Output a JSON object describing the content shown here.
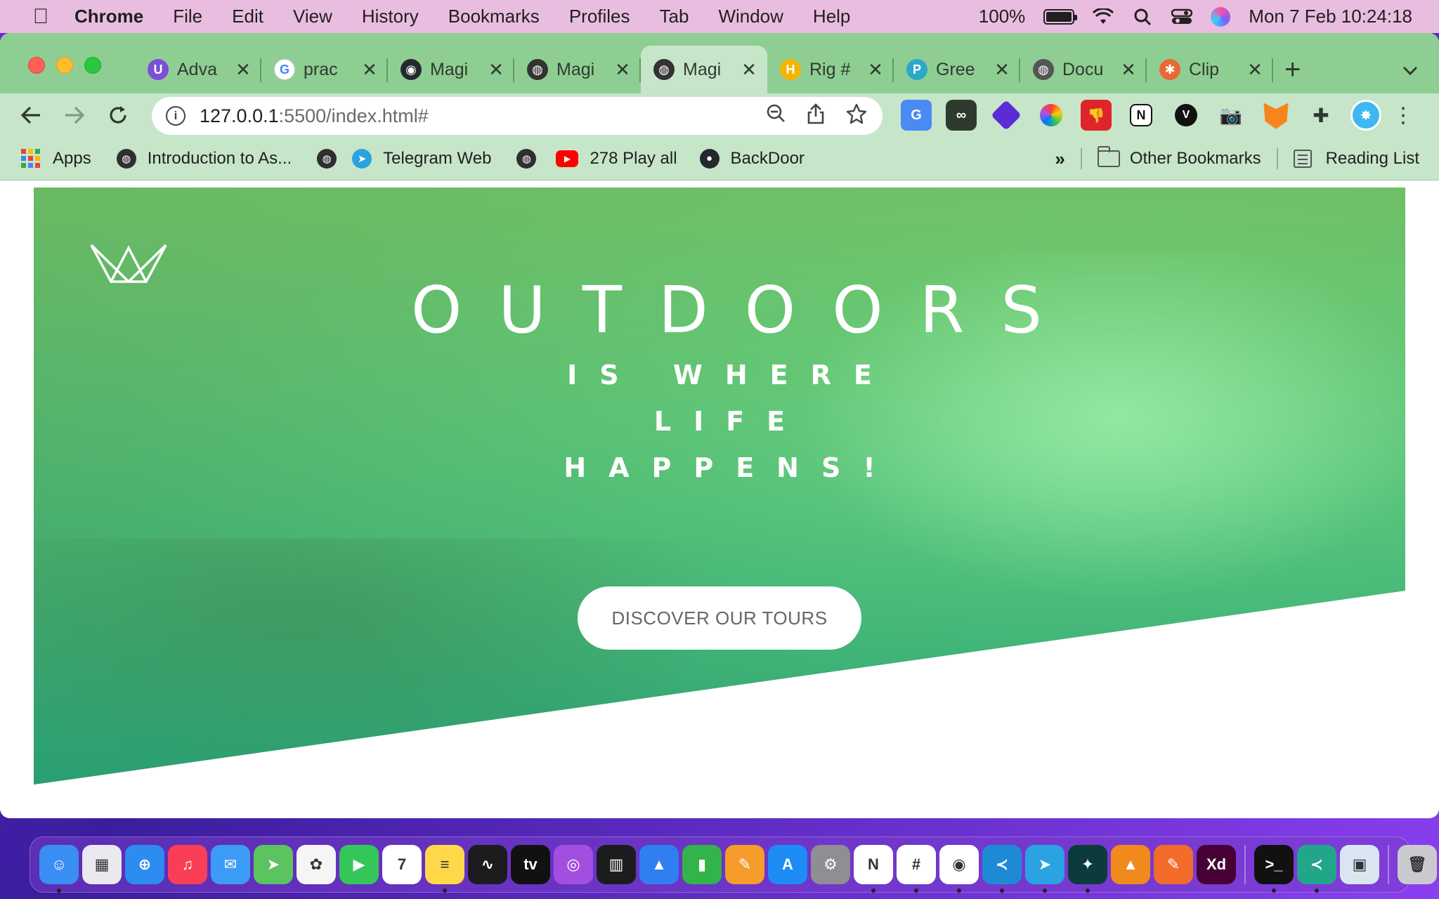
{
  "menubar": {
    "app_name": "Chrome",
    "menus": [
      "File",
      "Edit",
      "View",
      "History",
      "Bookmarks",
      "Profiles",
      "Tab",
      "Window",
      "Help"
    ],
    "battery_percent": "100%",
    "battery_level": 1.0,
    "datetime": "Mon 7 Feb  10:24:18"
  },
  "tabs": [
    {
      "title": "Adva",
      "favicon": "ublock-icon",
      "color": "#7b4fd6",
      "glyph": "U"
    },
    {
      "title": "prac",
      "favicon": "google-icon",
      "color": "#ffffff",
      "glyph": "G"
    },
    {
      "title": "Magi",
      "favicon": "github-icon",
      "color": "#24292f",
      "glyph": "◉"
    },
    {
      "title": "Magi",
      "favicon": "globe-icon",
      "color": "#333333",
      "glyph": "◍"
    },
    {
      "title": "Magi",
      "favicon": "globe-icon",
      "color": "#333333",
      "glyph": "◍",
      "active": true
    },
    {
      "title": "Rig #",
      "favicon": "hive-icon",
      "color": "#f5b400",
      "glyph": "H"
    },
    {
      "title": "Gree",
      "favicon": "docs-icon",
      "color": "#2da8c8",
      "glyph": "P"
    },
    {
      "title": "Docu",
      "favicon": "globe-icon",
      "color": "#555555",
      "glyph": "◍"
    },
    {
      "title": "Clip",
      "favicon": "clipchamp-icon",
      "color": "#e86a33",
      "glyph": "✱"
    }
  ],
  "omnibox": {
    "host": "127.0.0.1",
    "path": ":5500/index.html#"
  },
  "bookmarks": {
    "apps_label": "Apps",
    "items": [
      {
        "label": "Introduction to As...",
        "icon": "globe-icon"
      },
      {
        "label": "",
        "icon": "globe-icon"
      },
      {
        "label": "Telegram Web",
        "icon": "telegram-icon"
      },
      {
        "label": "",
        "icon": "globe-icon"
      },
      {
        "label": "278 Play all",
        "icon": "youtube-icon"
      },
      {
        "label": "BackDoor",
        "icon": "github-icon"
      }
    ],
    "overflow": "»",
    "other_label": "Other Bookmarks",
    "reading_label": "Reading List"
  },
  "hero": {
    "title": "OUTDOORS",
    "subtitle": "IS WHERE LIFE HAPPENS!",
    "cta_label": "DISCOVER OUR TOURS"
  },
  "colors": {
    "accent_green": "#7ed56f",
    "accent_teal": "#28b485",
    "chrome_frame": "#8fce93",
    "chrome_toolbar": "#c7e5c9"
  },
  "dock": {
    "apps": [
      {
        "name": "finder-icon",
        "color": "#3a8df2",
        "glyph": "☺",
        "running": true
      },
      {
        "name": "launchpad-icon",
        "color": "#e9e9ef",
        "glyph": "▦"
      },
      {
        "name": "safari-icon",
        "color": "#2d8cf0",
        "glyph": "⊕"
      },
      {
        "name": "music-icon",
        "color": "#fa3e57",
        "glyph": "♫"
      },
      {
        "name": "mail-icon",
        "color": "#3c9cf5",
        "glyph": "✉"
      },
      {
        "name": "maps-icon",
        "color": "#5cc361",
        "glyph": "➤"
      },
      {
        "name": "photos-icon",
        "color": "#f5f5f5",
        "glyph": "✿"
      },
      {
        "name": "facetime-icon",
        "color": "#35c659",
        "glyph": "▶"
      },
      {
        "name": "calendar-icon",
        "color": "#ffffff",
        "glyph": "7"
      },
      {
        "name": "notes-icon",
        "color": "#ffd84a",
        "glyph": "≡",
        "running": true
      },
      {
        "name": "stocks-icon",
        "color": "#1c1c1e",
        "glyph": "∿"
      },
      {
        "name": "appletv-icon",
        "color": "#111111",
        "glyph": "tv"
      },
      {
        "name": "podcasts-icon",
        "color": "#a24fe0",
        "glyph": "◎"
      },
      {
        "name": "activity-monitor-icon",
        "color": "#1c1c1e",
        "glyph": "▥"
      },
      {
        "name": "keynote-icon",
        "color": "#2f7ff0",
        "glyph": "▲"
      },
      {
        "name": "numbers-icon",
        "color": "#32b44a",
        "glyph": "▮"
      },
      {
        "name": "pages-icon",
        "color": "#f59c2b",
        "glyph": "✎"
      },
      {
        "name": "appstore-icon",
        "color": "#1e8cf5",
        "glyph": "A"
      },
      {
        "name": "system-preferences-icon",
        "color": "#8e8e93",
        "glyph": "⚙"
      },
      {
        "name": "notion-icon",
        "color": "#ffffff",
        "glyph": "N",
        "running": true
      },
      {
        "name": "slack-icon",
        "color": "#ffffff",
        "glyph": "#",
        "running": true
      },
      {
        "name": "chrome-icon",
        "color": "#ffffff",
        "glyph": "◉",
        "running": true
      },
      {
        "name": "vscode-icon",
        "color": "#1e8ad6",
        "glyph": "≺",
        "running": true
      },
      {
        "name": "telegram-icon",
        "color": "#2aa3e0",
        "glyph": "➤",
        "running": true
      },
      {
        "name": "gitkraken-icon",
        "color": "#0b3b3b",
        "glyph": "✦",
        "running": true
      },
      {
        "name": "vlc-icon",
        "color": "#f08a1c",
        "glyph": "▲"
      },
      {
        "name": "sketch-icon",
        "color": "#f26b2b",
        "glyph": "✎"
      },
      {
        "name": "adobe-xd-icon",
        "color": "#470137",
        "glyph": "Xd"
      }
    ],
    "recent": [
      {
        "name": "terminal-icon",
        "color": "#111111",
        "glyph": ">_",
        "running": true
      },
      {
        "name": "vscode-insiders-icon",
        "color": "#22a68a",
        "glyph": "≺",
        "running": true
      },
      {
        "name": "preview-icon",
        "color": "#d9e6f2",
        "glyph": "▣"
      }
    ],
    "trash": {
      "name": "trash-icon",
      "color": "#c9c9cf",
      "glyph": "🗑"
    }
  }
}
